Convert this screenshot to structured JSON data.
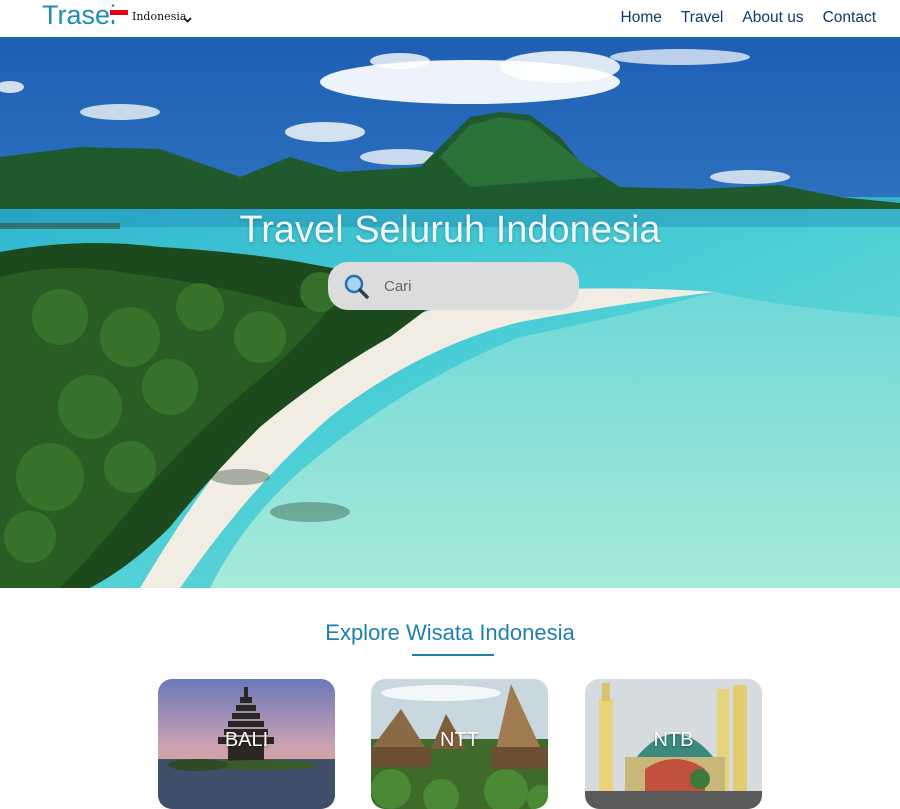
{
  "navbar": {
    "logo": "Trasei",
    "country": "Indonesia",
    "links": [
      "Home",
      "Travel",
      "About us",
      "Contact"
    ]
  },
  "hero": {
    "title": "Travel Seluruh Indonesia",
    "search_placeholder": "Cari"
  },
  "explore": {
    "heading": "Explore Wisata Indonesia",
    "cards": [
      "BALI",
      "NTT",
      "NTB"
    ]
  },
  "icons": {
    "search": "magnifier-icon",
    "chevron": "chevron-down-icon",
    "flag": "indonesia-flag-icon"
  },
  "colors": {
    "brand": "#1a8fb3",
    "nav_text": "#0d3b6b",
    "heading": "#1f7fb0"
  }
}
